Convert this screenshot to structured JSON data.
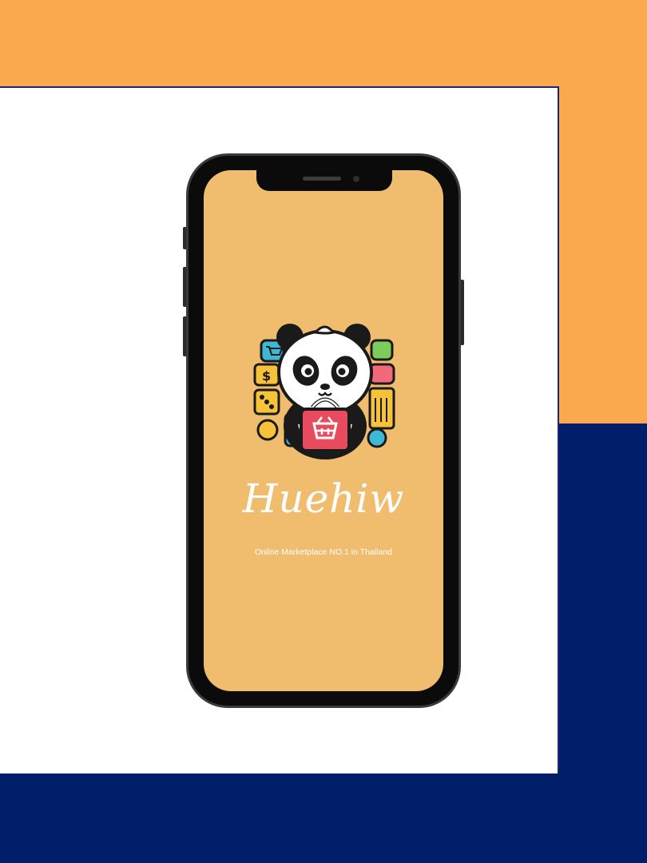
{
  "app": {
    "brand_name": "Huehiw",
    "tagline": "Online Marketplace NO.1 in Thailand"
  },
  "logo": {
    "icon": "panda-shopping-bag-icon",
    "surrounding_icons": [
      "cart-icon",
      "dollar-icon",
      "gift-icon",
      "tag-icon",
      "receipt-icon",
      "coin-icon",
      "dice-icon"
    ]
  },
  "colors": {
    "background_top": "#FBA94F",
    "background_bottom": "#001E6A",
    "panel": "#FFFFFF",
    "screen": "#F0BD6F",
    "bag": "#E94B5E"
  }
}
